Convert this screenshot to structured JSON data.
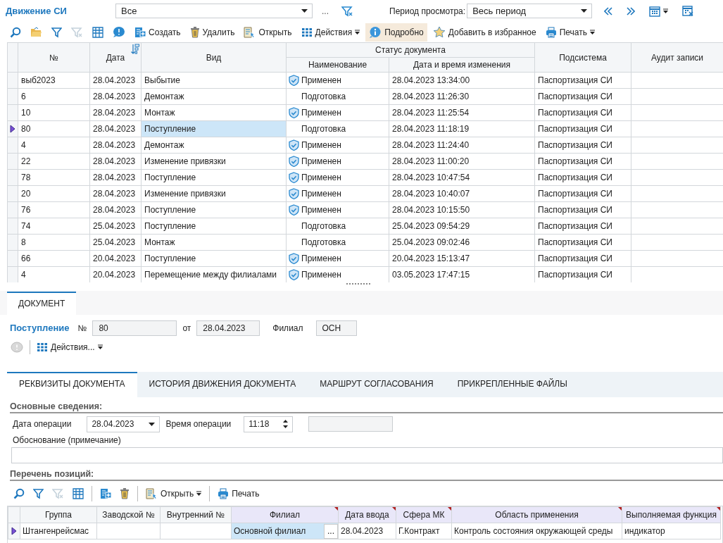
{
  "header": {
    "title": "Движение СИ",
    "filter_value": "Все",
    "more_label": "...",
    "period_label": "Период просмотра:",
    "period_value": "Весь период"
  },
  "toolbar": [
    {
      "dropdown": false,
      "disabled": false,
      "pressed": false
    },
    {
      "dropdown": false,
      "disabled": false,
      "pressed": false
    },
    {
      "dropdown": false,
      "disabled": false,
      "pressed": false
    },
    {
      "dropdown": false,
      "disabled": true,
      "pressed": false
    },
    {
      "dropdown": false,
      "disabled": false,
      "pressed": false
    },
    {
      "dropdown": false,
      "disabled": false,
      "pressed": false
    },
    {
      "label": "Создать",
      "dropdown": false,
      "disabled": false,
      "pressed": false
    },
    {
      "label": "Удалить",
      "dropdown": false,
      "disabled": false,
      "pressed": false
    },
    {
      "label": "Открыть",
      "dropdown": false,
      "disabled": false,
      "pressed": false
    },
    {
      "label": "Действия",
      "dropdown": true,
      "disabled": false,
      "pressed": false
    },
    {
      "label": "Подробно",
      "dropdown": false,
      "disabled": false,
      "pressed": true
    },
    {
      "label": "Добавить в избранное",
      "dropdown": false,
      "disabled": false,
      "pressed": false
    },
    {
      "label": "Печать",
      "dropdown": true,
      "disabled": false,
      "pressed": false
    }
  ],
  "table": {
    "columns": {
      "number": "№",
      "date": "Дата",
      "type": "Вид",
      "status_group": "Статус документа",
      "status": "Наименование",
      "changed": "Дата и время изменения",
      "subsystem": "Подсистема",
      "audit": "Аудит записи"
    },
    "rows": [
      {
        "number": "выб2023",
        "date": "28.04.2023",
        "type": "Выбытие",
        "verified": true,
        "status": "Применен",
        "changed": "28.04.2023 13:34:00",
        "subsystem": "Паспортизация СИ",
        "selected": false
      },
      {
        "number": "6",
        "date": "28.04.2023",
        "type": "Демонтаж",
        "verified": false,
        "status": "Подготовка",
        "changed": "28.04.2023 11:26:30",
        "subsystem": "Паспортизация СИ",
        "selected": false
      },
      {
        "number": "10",
        "date": "28.04.2023",
        "type": "Монтаж",
        "verified": true,
        "status": "Применен",
        "changed": "28.04.2023 11:25:54",
        "subsystem": "Паспортизация СИ",
        "selected": false
      },
      {
        "number": "80",
        "date": "28.04.2023",
        "type": "Поступление",
        "verified": false,
        "status": "Подготовка",
        "changed": "28.04.2023 11:18:19",
        "subsystem": "Паспортизация СИ",
        "selected": true
      },
      {
        "number": "4",
        "date": "28.04.2023",
        "type": "Демонтаж",
        "verified": true,
        "status": "Применен",
        "changed": "28.04.2023 11:24:40",
        "subsystem": "Паспортизация СИ",
        "selected": false
      },
      {
        "number": "22",
        "date": "28.04.2023",
        "type": "Изменение привязки",
        "verified": true,
        "status": "Применен",
        "changed": "28.04.2023 11:00:20",
        "subsystem": "Паспортизация СИ",
        "selected": false
      },
      {
        "number": "78",
        "date": "28.04.2023",
        "type": "Поступление",
        "verified": true,
        "status": "Применен",
        "changed": "28.04.2023 10:47:54",
        "subsystem": "Паспортизация СИ",
        "selected": false
      },
      {
        "number": "20",
        "date": "28.04.2023",
        "type": "Изменение привязки",
        "verified": true,
        "status": "Применен",
        "changed": "28.04.2023 10:40:07",
        "subsystem": "Паспортизация СИ",
        "selected": false
      },
      {
        "number": "76",
        "date": "28.04.2023",
        "type": "Поступление",
        "verified": true,
        "status": "Применен",
        "changed": "28.04.2023 10:15:50",
        "subsystem": "Паспортизация СИ",
        "selected": false
      },
      {
        "number": "74",
        "date": "25.04.2023",
        "type": "Поступление",
        "verified": false,
        "status": "Подготовка",
        "changed": "25.04.2023 09:54:29",
        "subsystem": "Паспортизация СИ",
        "selected": false
      },
      {
        "number": "8",
        "date": "25.04.2023",
        "type": "Монтаж",
        "verified": false,
        "status": "Подготовка",
        "changed": "25.04.2023 09:02:46",
        "subsystem": "Паспортизация СИ",
        "selected": false
      },
      {
        "number": "66",
        "date": "20.04.2023",
        "type": "Поступление",
        "verified": true,
        "status": "Применен",
        "changed": "20.04.2023 15:13:47",
        "subsystem": "Паспортизация СИ",
        "selected": false
      },
      {
        "number": "4",
        "date": "20.04.2023",
        "type": "Перемещение между филиалами",
        "verified": true,
        "status": "Применен",
        "changed": "03.05.2023 17:47:15",
        "subsystem": "Паспортизация СИ",
        "selected": false
      }
    ]
  },
  "document": {
    "tab": "ДОКУМЕНТ",
    "type": "Поступление",
    "number_label": "№",
    "number": "80",
    "date_label": "от",
    "date": "28.04.2023",
    "branch_label": "Филиал",
    "branch": "ОСН",
    "actions_label": "Действия...",
    "tabs": [
      {
        "label": "РЕКВИЗИТЫ ДОКУМЕНТА",
        "selected": true
      },
      {
        "label": "ИСТОРИЯ ДВИЖЕНИЯ ДОКУМЕНТА",
        "selected": false
      },
      {
        "label": "МАРШРУТ СОГЛАСОВАНИЯ",
        "selected": false
      },
      {
        "label": "ПРИКРЕПЛЕННЫЕ ФАЙЛЫ",
        "selected": false
      }
    ],
    "main_section": "Основные сведения:",
    "op_date_label": "Дата операции",
    "op_date": "28.04.2023",
    "op_time_label": "Время операции",
    "op_time": "11:18",
    "reason_label": "Обоснование (примечание)",
    "items_section": "Перечень позиций:",
    "items_more": "...",
    "items_toolbar": [
      {
        "dropdown": false,
        "disabled": false
      },
      {
        "dropdown": false,
        "disabled": false
      },
      {
        "dropdown": false,
        "disabled": true
      },
      {
        "dropdown": false,
        "disabled": false
      },
      {
        "dropdown": false,
        "disabled": false
      },
      {
        "dropdown": false,
        "disabled": false
      },
      {
        "label": "Открыть",
        "dropdown": true,
        "disabled": false
      },
      {
        "label": "Печать",
        "dropdown": false,
        "disabled": false
      }
    ],
    "items": {
      "columns": [
        {
          "label": "Группа",
          "required": false
        },
        {
          "label": "Заводской №",
          "required": false
        },
        {
          "label": "Внутренний №",
          "required": false
        },
        {
          "label": "Филиал",
          "required": true
        },
        {
          "label": "Дата ввода",
          "required": true
        },
        {
          "label": "Сфера МК",
          "required": true
        },
        {
          "label": "Область применения",
          "required": true
        },
        {
          "label": "Выполняемая функция",
          "required": true
        }
      ],
      "rows": [
        {
          "selected": true,
          "cells": [
            "Штангенрейсмас",
            null,
            null,
            "Основной филиал",
            "28.04.2023",
            "Г.Контракт",
            "Контроль состояния окружающей среды",
            "индикатор"
          ]
        }
      ]
    }
  }
}
